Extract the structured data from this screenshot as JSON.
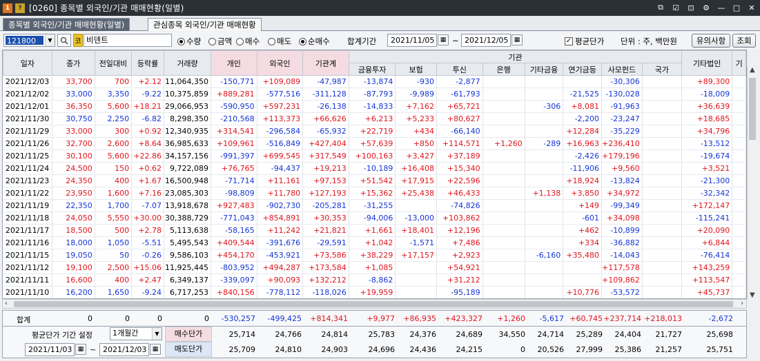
{
  "title": {
    "code": "0260",
    "text": "[0260] 종목별 외국인/기관 매매현황(일별)"
  },
  "tabs": {
    "active": "종목별 외국인/기관 매매현황(일별)",
    "inactive": "관심종목 외국인/기관 매매현황"
  },
  "toolbar": {
    "stock_code": "121800",
    "stock_tag": "코",
    "stock_name": "비덴트",
    "radio_qty": "수량",
    "radio_amt": "금액",
    "radio_buy": "매수",
    "radio_sell": "매도",
    "radio_net": "순매수",
    "period_label": "합계기간",
    "date_from": "2021/11/05",
    "tilde": "~",
    "date_to": "2021/12/05",
    "avg_price_label": "평균단가",
    "unit_label": "단위 : 주, 백만원",
    "notes_button": "유의사항",
    "query_button": "조회"
  },
  "columns": {
    "date": "일자",
    "close": "종가",
    "change": "전일대비",
    "rate": "등락률",
    "volume": "거래량",
    "individual": "개인",
    "foreign": "외국인",
    "inst_total": "기관계",
    "inst_group": "기관",
    "finance": "금융투자",
    "insurance": "보험",
    "trust": "투신",
    "bank": "은행",
    "other_finance": "기타금융",
    "pension": "연기금등",
    "private_fund": "사모펀드",
    "nation": "국가",
    "other_corp": "기타법인",
    "more": "기"
  },
  "rows": [
    {
      "date": "2021/12/03",
      "close": "33,700",
      "change": "700",
      "rate": "+2.12",
      "volume": "11,064,350",
      "ind": "-150,771",
      "frg": "+109,089",
      "inst": "-47,987",
      "fin": "-13,874",
      "ins": "-930",
      "trust": "-2,877",
      "bank": "",
      "ofin": "",
      "pen": "",
      "pf": "-30,306",
      "nat": "",
      "corp": "+89,300",
      "dir": "up"
    },
    {
      "date": "2021/12/02",
      "close": "33,000",
      "change": "3,350",
      "rate": "-9.22",
      "volume": "10,375,859",
      "ind": "+889,281",
      "frg": "-577,516",
      "inst": "-311,128",
      "fin": "-87,793",
      "ins": "-9,989",
      "trust": "-61,793",
      "bank": "",
      "ofin": "",
      "pen": "-21,525",
      "pf": "-130,028",
      "nat": "",
      "corp": "-18,009",
      "dir": "down"
    },
    {
      "date": "2021/12/01",
      "close": "36,350",
      "change": "5,600",
      "rate": "+18.21",
      "volume": "29,066,953",
      "ind": "-590,950",
      "frg": "+597,231",
      "inst": "-26,138",
      "fin": "-14,833",
      "ins": "+7,162",
      "trust": "+65,721",
      "bank": "",
      "ofin": "-306",
      "pen": "+8,081",
      "pf": "-91,963",
      "nat": "",
      "corp": "+36,639",
      "dir": "up"
    },
    {
      "date": "2021/11/30",
      "close": "30,750",
      "change": "2,250",
      "rate": "-6.82",
      "volume": "8,298,350",
      "ind": "-210,568",
      "frg": "+113,373",
      "inst": "+66,626",
      "fin": "+6,213",
      "ins": "+5,233",
      "trust": "+80,627",
      "bank": "",
      "ofin": "",
      "pen": "-2,200",
      "pf": "-23,247",
      "nat": "",
      "corp": "+18,685",
      "dir": "down"
    },
    {
      "date": "2021/11/29",
      "close": "33,000",
      "change": "300",
      "rate": "+0.92",
      "volume": "12,340,935",
      "ind": "+314,541",
      "frg": "-296,584",
      "inst": "-65,932",
      "fin": "+22,719",
      "ins": "+434",
      "trust": "-66,140",
      "bank": "",
      "ofin": "",
      "pen": "+12,284",
      "pf": "-35,229",
      "nat": "",
      "corp": "+34,796",
      "dir": "up"
    },
    {
      "date": "2021/11/26",
      "close": "32,700",
      "change": "2,600",
      "rate": "+8.64",
      "volume": "36,985,633",
      "ind": "+109,961",
      "frg": "-516,849",
      "inst": "+427,404",
      "fin": "+57,639",
      "ins": "+850",
      "trust": "+114,571",
      "bank": "+1,260",
      "ofin": "-289",
      "pen": "+16,963",
      "pf": "+236,410",
      "nat": "",
      "corp": "-13,512",
      "dir": "up"
    },
    {
      "date": "2021/11/25",
      "close": "30,100",
      "change": "5,600",
      "rate": "+22.86",
      "volume": "34,157,156",
      "ind": "-991,397",
      "frg": "+699,545",
      "inst": "+317,549",
      "fin": "+100,163",
      "ins": "+3,427",
      "trust": "+37,189",
      "bank": "",
      "ofin": "",
      "pen": "-2,426",
      "pf": "+179,196",
      "nat": "",
      "corp": "-19,674",
      "dir": "up"
    },
    {
      "date": "2021/11/24",
      "close": "24,500",
      "change": "150",
      "rate": "+0.62",
      "volume": "9,722,089",
      "ind": "+76,765",
      "frg": "-94,437",
      "inst": "+19,213",
      "fin": "-10,189",
      "ins": "+16,408",
      "trust": "+15,340",
      "bank": "",
      "ofin": "",
      "pen": "-11,906",
      "pf": "+9,560",
      "nat": "",
      "corp": "+3,521",
      "dir": "up"
    },
    {
      "date": "2021/11/23",
      "close": "24,350",
      "change": "400",
      "rate": "+1.67",
      "volume": "16,500,948",
      "ind": "-71,714",
      "frg": "+11,161",
      "inst": "+97,153",
      "fin": "+51,542",
      "ins": "+17,915",
      "trust": "+22,596",
      "bank": "",
      "ofin": "",
      "pen": "+18,924",
      "pf": "-13,824",
      "nat": "",
      "corp": "-21,300",
      "dir": "up"
    },
    {
      "date": "2021/11/22",
      "close": "23,950",
      "change": "1,600",
      "rate": "+7.16",
      "volume": "23,085,303",
      "ind": "-98,809",
      "frg": "+11,780",
      "inst": "+127,193",
      "fin": "+15,362",
      "ins": "+25,438",
      "trust": "+46,433",
      "bank": "",
      "ofin": "+1,138",
      "pen": "+3,850",
      "pf": "+34,972",
      "nat": "",
      "corp": "-32,342",
      "dir": "up"
    },
    {
      "date": "2021/11/19",
      "close": "22,350",
      "change": "1,700",
      "rate": "-7.07",
      "volume": "13,918,678",
      "ind": "+927,483",
      "frg": "-902,730",
      "inst": "-205,281",
      "fin": "-31,255",
      "ins": "",
      "trust": "-74,826",
      "bank": "",
      "ofin": "",
      "pen": "+149",
      "pf": "-99,349",
      "nat": "",
      "corp": "+172,147",
      "dir": "down"
    },
    {
      "date": "2021/11/18",
      "close": "24,050",
      "change": "5,550",
      "rate": "+30.00",
      "volume": "30,388,729",
      "ind": "-771,043",
      "frg": "+854,891",
      "inst": "+30,353",
      "fin": "-94,006",
      "ins": "-13,000",
      "trust": "+103,862",
      "bank": "",
      "ofin": "",
      "pen": "-601",
      "pf": "+34,098",
      "nat": "",
      "corp": "-115,241",
      "dir": "up"
    },
    {
      "date": "2021/11/17",
      "close": "18,500",
      "change": "500",
      "rate": "+2.78",
      "volume": "5,113,638",
      "ind": "-58,165",
      "frg": "+11,242",
      "inst": "+21,821",
      "fin": "+1,661",
      "ins": "+18,401",
      "trust": "+12,196",
      "bank": "",
      "ofin": "",
      "pen": "+462",
      "pf": "-10,899",
      "nat": "",
      "corp": "+20,090",
      "dir": "up"
    },
    {
      "date": "2021/11/16",
      "close": "18,000",
      "change": "1,050",
      "rate": "-5.51",
      "volume": "5,495,543",
      "ind": "+409,544",
      "frg": "-391,676",
      "inst": "-29,591",
      "fin": "+1,042",
      "ins": "-1,571",
      "trust": "+7,486",
      "bank": "",
      "ofin": "",
      "pen": "+334",
      "pf": "-36,882",
      "nat": "",
      "corp": "+6,844",
      "dir": "down"
    },
    {
      "date": "2021/11/15",
      "close": "19,050",
      "change": "50",
      "rate": "-0.26",
      "volume": "9,586,103",
      "ind": "+454,170",
      "frg": "-453,921",
      "inst": "+73,586",
      "fin": "+38,229",
      "ins": "+17,157",
      "trust": "+2,923",
      "bank": "",
      "ofin": "-6,160",
      "pen": "+35,480",
      "pf": "-14,043",
      "nat": "",
      "corp": "-76,414",
      "dir": "down"
    },
    {
      "date": "2021/11/12",
      "close": "19,100",
      "change": "2,500",
      "rate": "+15.06",
      "volume": "11,925,445",
      "ind": "-803,952",
      "frg": "+494,287",
      "inst": "+173,584",
      "fin": "+1,085",
      "ins": "",
      "trust": "+54,921",
      "bank": "",
      "ofin": "",
      "pen": "",
      "pf": "+117,578",
      "nat": "",
      "corp": "+143,259",
      "dir": "up"
    },
    {
      "date": "2021/11/11",
      "close": "16,600",
      "change": "400",
      "rate": "+2.47",
      "volume": "6,349,137",
      "ind": "-339,097",
      "frg": "+90,093",
      "inst": "+132,212",
      "fin": "-8,862",
      "ins": "",
      "trust": "+31,212",
      "bank": "",
      "ofin": "",
      "pen": "",
      "pf": "+109,862",
      "nat": "",
      "corp": "+113,547",
      "dir": "up"
    },
    {
      "date": "2021/11/10",
      "close": "16,200",
      "change": "1,650",
      "rate": "-9.24",
      "volume": "6,717,253",
      "ind": "+840,156",
      "frg": "-778,112",
      "inst": "-118,026",
      "fin": "+19,959",
      "ins": "",
      "trust": "-95,189",
      "bank": "",
      "ofin": "",
      "pen": "+10,776",
      "pf": "-53,572",
      "nat": "",
      "corp": "+45,737",
      "dir": "down"
    }
  ],
  "sum": {
    "label": "합계",
    "close": "0",
    "change": "0",
    "rate": "0",
    "volume": "0",
    "ind": "-530,257",
    "frg": "-499,425",
    "inst": "+814,341",
    "fin": "+9,977",
    "ins": "+86,935",
    "trust": "+423,327",
    "bank": "+1,260",
    "ofin": "-5,617",
    "pen": "+60,745",
    "pf": "+237,714",
    "nat": "+218,013",
    "corp": "-2,672"
  },
  "avg": {
    "period_label": "평균단가 기간 설정",
    "period_value": "1개월간",
    "from": "2021/11/03",
    "tilde": "~",
    "to": "2021/12/03",
    "buy_label": "매수단가",
    "sell_label": "매도단가",
    "buy": [
      "25,714",
      "24,766",
      "24,814",
      "25,783",
      "24,376",
      "24,689",
      "34,550",
      "24,714",
      "25,289",
      "24,404",
      "21,727",
      "25,698"
    ],
    "sell": [
      "25,709",
      "24,810",
      "24,903",
      "24,696",
      "24,436",
      "24,215",
      "0",
      "20,526",
      "27,999",
      "25,386",
      "21,257",
      "25,751"
    ]
  },
  "colors": {
    "up": "#e0141d",
    "down": "#1434d6",
    "title_bg": "#2b2f36",
    "tab_active": "#5b6472",
    "header_pink": "#f5dce2"
  }
}
